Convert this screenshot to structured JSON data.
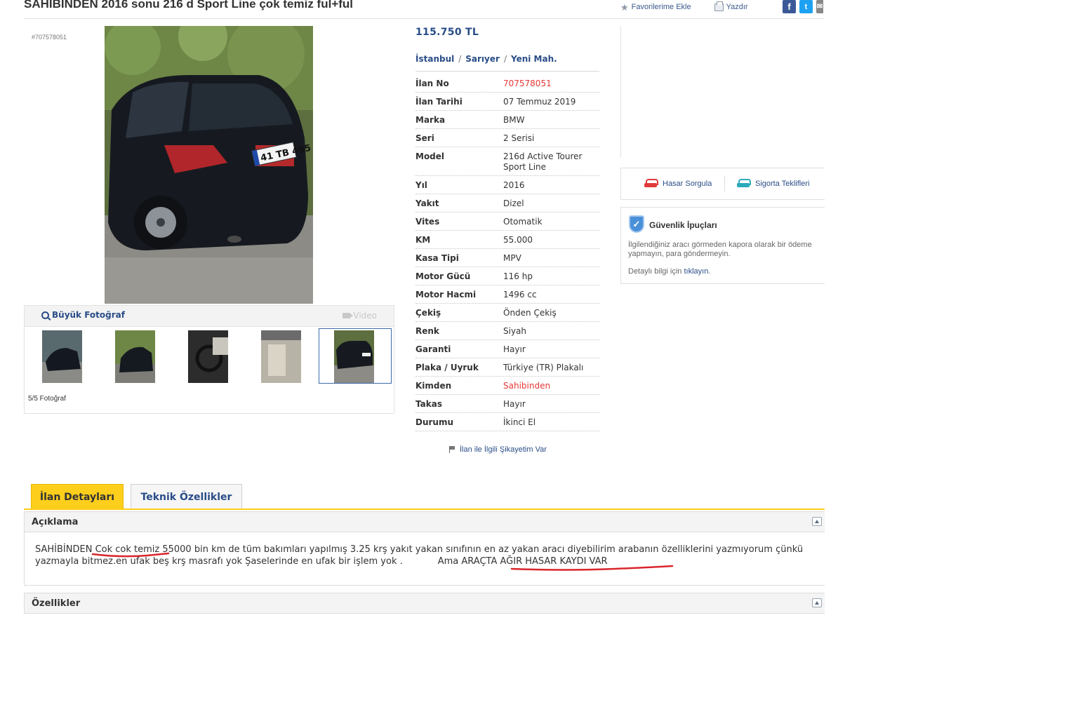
{
  "listing": {
    "title": "SAHİBİNDEN 2016 sonu 216 d Sport Line çok temiz ful+ful",
    "ad_code": "#707578051",
    "price": "115.750 TL",
    "location": {
      "city": "İstanbul",
      "district": "Sarıyer",
      "neighborhood": "Yeni Mah."
    }
  },
  "top_actions": {
    "favorite": "Favorilerime Ekle",
    "print": "Yazdır"
  },
  "photos": {
    "large_photo": "Büyük Fotoğraf",
    "video": "Video",
    "count": "5/5 Fotoğraf"
  },
  "specs": [
    {
      "label": "İlan No",
      "value": "707578051",
      "highlight": true
    },
    {
      "label": "İlan Tarihi",
      "value": "07 Temmuz 2019"
    },
    {
      "label": "Marka",
      "value": "BMW"
    },
    {
      "label": "Seri",
      "value": "2 Serisi"
    },
    {
      "label": "Model",
      "value": "216d Active Tourer Sport Line"
    },
    {
      "label": "Yıl",
      "value": "2016"
    },
    {
      "label": "Yakıt",
      "value": "Dizel"
    },
    {
      "label": "Vites",
      "value": "Otomatik"
    },
    {
      "label": "KM",
      "value": "55.000"
    },
    {
      "label": "Kasa Tipi",
      "value": "MPV"
    },
    {
      "label": "Motor Gücü",
      "value": "116 hp"
    },
    {
      "label": "Motor Hacmi",
      "value": "1496 cc"
    },
    {
      "label": "Çekiş",
      "value": "Önden Çekiş"
    },
    {
      "label": "Renk",
      "value": "Siyah"
    },
    {
      "label": "Garanti",
      "value": "Hayır"
    },
    {
      "label": "Plaka / Uyruk",
      "value": "Türkiye (TR) Plakalı"
    },
    {
      "label": "Kimden",
      "value": "Sahibinden",
      "highlight": true
    },
    {
      "label": "Takas",
      "value": "Hayır"
    },
    {
      "label": "Durumu",
      "value": "İkinci El"
    }
  ],
  "complaint": "İlan ile İlgili Şikayetim Var",
  "services": {
    "damage_query": "Hasar Sorgula",
    "insurance": "Sigorta Teklifleri"
  },
  "safety": {
    "title": "Güvenlik İpuçları",
    "text": "İlgilendiğiniz aracı görmeden kapora olarak bir ödeme yapmayın, para göndermeyin.",
    "more_prefix": "Detaylı bilgi için ",
    "more_link": "tıklayın",
    "more_suffix": "."
  },
  "tabs": {
    "details": "İlan Detayları",
    "technical": "Teknik Özellikler"
  },
  "description": {
    "heading": "Açıklama",
    "part1": "SAHİBİNDEN ",
    "underlined1": "Cok cok temiz ",
    "part2": "55000 bin km de tüm bakımları yapılmış 3.25 krş yakıt yakan sınıfının en az yakan aracı diyebilirim arabanın özelliklerini yazmıyorum çünkü yazmayla bitmez.en ufak beş krş masrafı yok Şaselerinde en ufak bir işlem yok .",
    "part3": "Ama ",
    "underlined2": "ARAÇTA AĞIR HASAR KAYDI VAR"
  },
  "features": {
    "heading": "Özellikler"
  },
  "colors": {
    "link": "#2a4d87",
    "highlight": "#e53935",
    "tab_active": "#fece1c"
  }
}
